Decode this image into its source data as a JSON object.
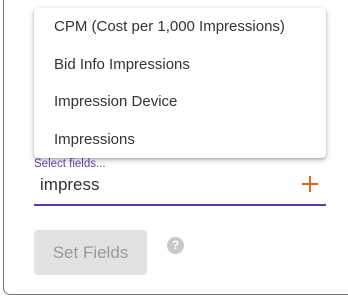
{
  "dropdown": {
    "options": [
      {
        "label": "CPM (Cost per 1,000 Impressions)"
      },
      {
        "label": "Bid Info Impressions"
      },
      {
        "label": "Impression Device"
      },
      {
        "label": "Impressions"
      }
    ]
  },
  "field": {
    "label": "Select fields...",
    "value": "impress"
  },
  "actions": {
    "set_fields_label": "Set Fields",
    "help_glyph": "?"
  },
  "colors": {
    "accent": "#5e3aa6",
    "add_icon": "#e06a1b",
    "disabled_button_bg": "#e2e2e2"
  },
  "icons": {
    "add": "plus-icon",
    "help": "help-circle-icon"
  }
}
